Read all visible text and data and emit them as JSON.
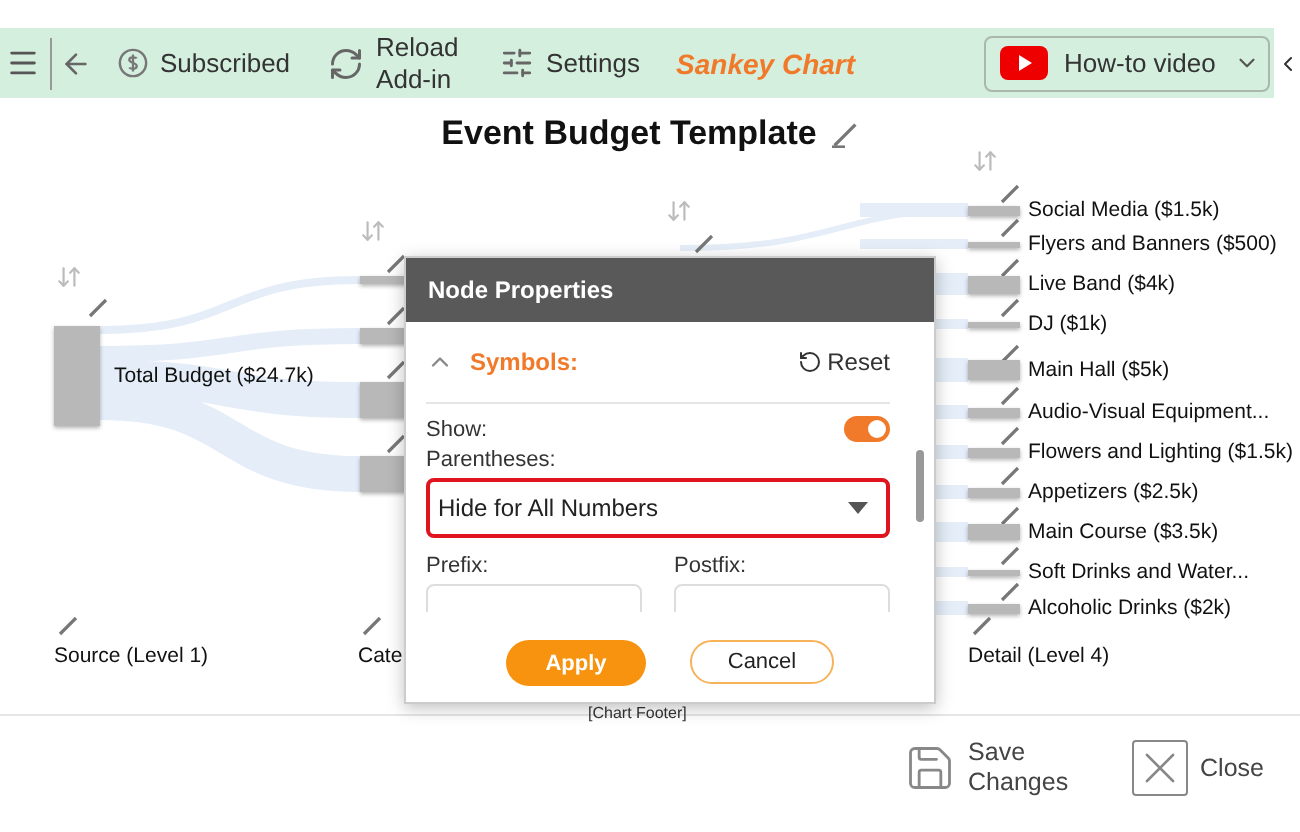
{
  "toolbar": {
    "subscribed": "Subscribed",
    "reload": "Reload Add-in",
    "settings": "Settings",
    "app_title": "Sankey Chart",
    "video_button": "How-to video"
  },
  "chart": {
    "title": "Event Budget Template",
    "source": {
      "label": "Total Budget ($24.7k)"
    },
    "details": [
      {
        "label": "Social Media ($1.5k)"
      },
      {
        "label": "Flyers and Banners ($500)"
      },
      {
        "label": "Live Band ($4k)"
      },
      {
        "label": "DJ ($1k)"
      },
      {
        "label": "Main Hall ($5k)"
      },
      {
        "label": "Audio-Visual Equipment..."
      },
      {
        "label": "Flowers and Lighting ($1.5k)"
      },
      {
        "label": "Appetizers ($2.5k)"
      },
      {
        "label": "Main Course ($3.5k)"
      },
      {
        "label": "Soft Drinks and Water..."
      },
      {
        "label": "Alcoholic Drinks ($2k)"
      }
    ],
    "level_labels": [
      "Source (Level 1)",
      "Cate",
      "Detail (Level 4)"
    ],
    "footer": "[Chart Footer]"
  },
  "dialog": {
    "title": "Node Properties",
    "section": {
      "label": "Symbols:",
      "expanded": true
    },
    "reset": "Reset",
    "show": {
      "label": "Show:",
      "on": true
    },
    "parentheses": {
      "label": "Parentheses:",
      "value": "Hide for All Numbers"
    },
    "prefix": "Prefix:",
    "postfix": "Postfix:",
    "apply": "Apply",
    "cancel": "Cancel"
  },
  "footer_bar": {
    "save": "Save Changes",
    "close": "Close"
  }
}
